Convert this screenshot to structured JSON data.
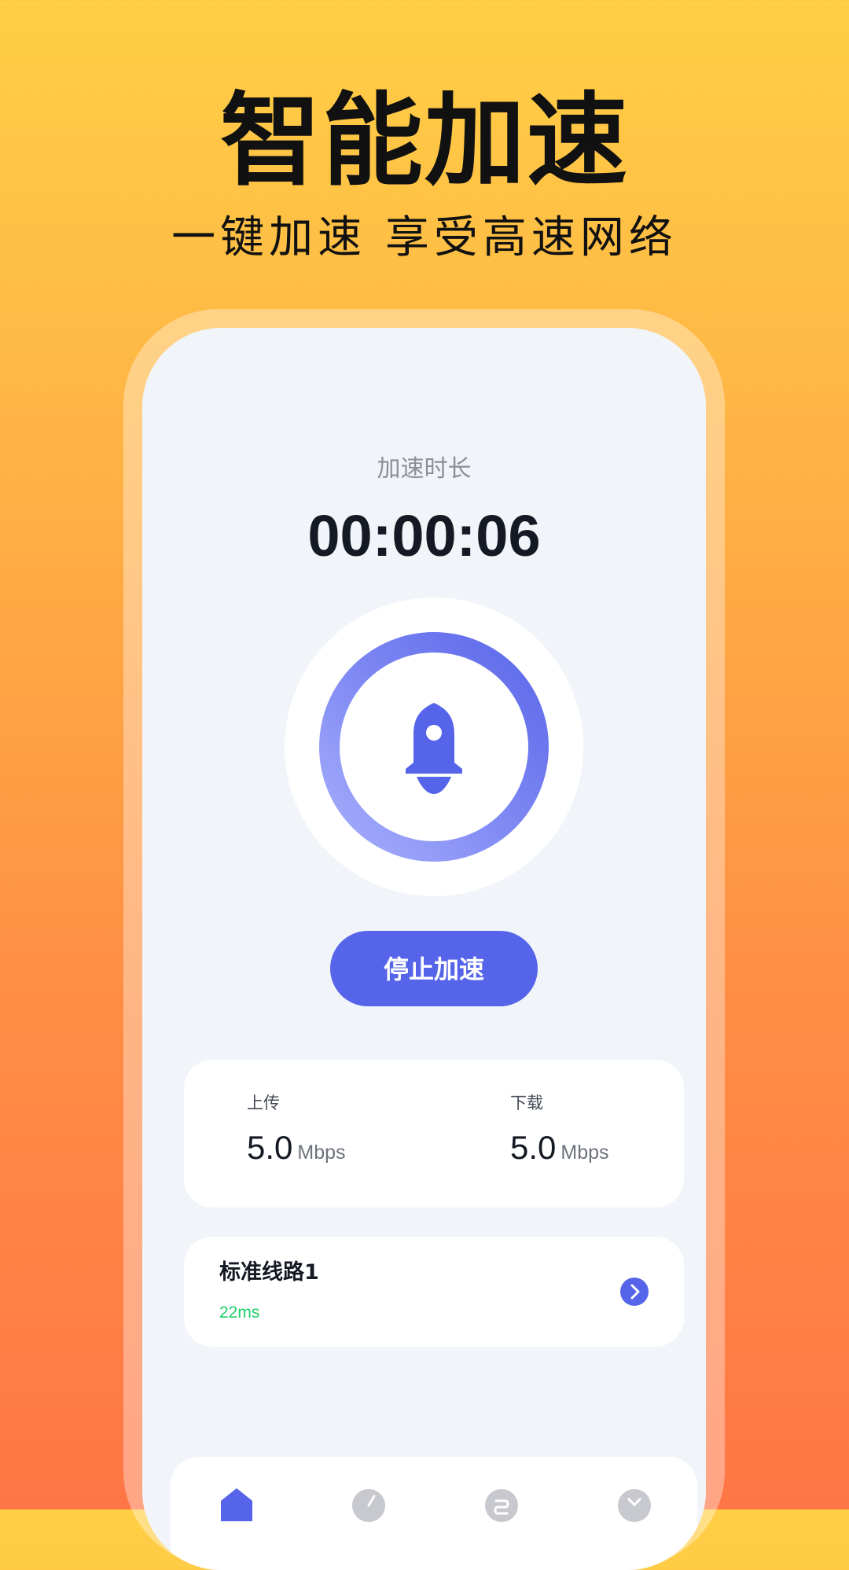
{
  "hero": {
    "title": "智能加速",
    "subtitle": "一键加速 享受高速网络"
  },
  "accelerator": {
    "timer_label": "加速时长",
    "timer_value": "00:00:06",
    "stop_label": "停止加速"
  },
  "speed": {
    "upload": {
      "label": "上传",
      "value": "5.0",
      "unit": "Mbps"
    },
    "download": {
      "label": "下载",
      "value": "5.0",
      "unit": "Mbps"
    }
  },
  "route": {
    "name": "标准线路1",
    "latency": "22ms"
  },
  "nav": {
    "items": [
      {
        "icon": "home-icon",
        "active": true
      },
      {
        "icon": "speedometer-icon",
        "active": false
      },
      {
        "icon": "route-icon",
        "active": false
      },
      {
        "icon": "user-icon",
        "active": false
      }
    ]
  },
  "colors": {
    "accent": "#5564e9",
    "latency_green": "#1ccf6a",
    "background_top": "#ffcf45",
    "background_bottom": "#ff7646"
  }
}
